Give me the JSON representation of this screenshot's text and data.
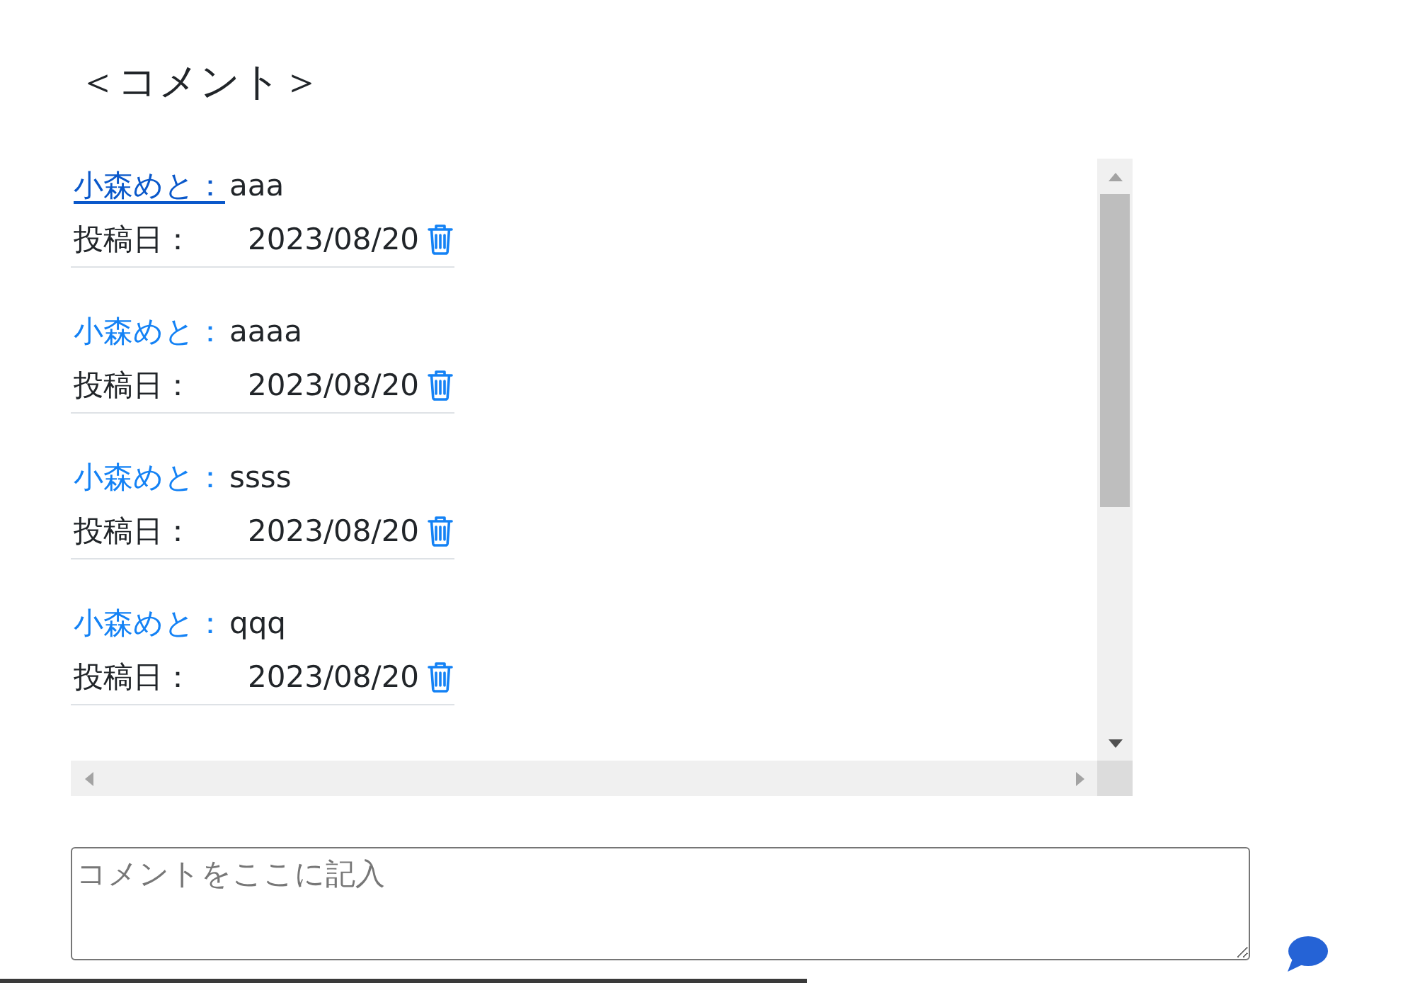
{
  "page": {
    "title": "＜コメント＞"
  },
  "comments": [
    {
      "author": "小森めと：",
      "text": "aaa",
      "date_label": "投稿日：",
      "date": "2023/08/20",
      "hovered": true
    },
    {
      "author": "小森めと：",
      "text": "aaaa",
      "date_label": "投稿日：",
      "date": "2023/08/20",
      "hovered": false
    },
    {
      "author": "小森めと：",
      "text": "ssss",
      "date_label": "投稿日：",
      "date": "2023/08/20",
      "hovered": false
    },
    {
      "author": "小森めと：",
      "text": "qqq",
      "date_label": "投稿日：",
      "date": "2023/08/20",
      "hovered": false
    }
  ],
  "comment_form": {
    "placeholder": "コメントをここに記入"
  }
}
